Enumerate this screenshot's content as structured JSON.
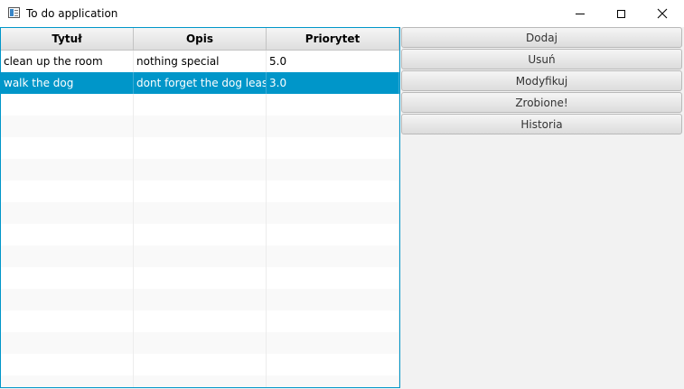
{
  "window": {
    "title": "To do application",
    "controls": [
      "minimize",
      "maximize",
      "close"
    ]
  },
  "table": {
    "columns": [
      "Tytuł",
      "Opis",
      "Priorytet"
    ],
    "rows": [
      {
        "title": "clean up the room",
        "description": "nothing special",
        "priority": "5.0",
        "selected": false
      },
      {
        "title": "walk the dog",
        "description": "dont forget the dog leash",
        "priority": "3.0",
        "selected": true
      }
    ],
    "selected_color": "#0096c9"
  },
  "actions": {
    "add": "Dodaj",
    "remove": "Usuń",
    "modify": "Modyfikuj",
    "done": "Zrobione!",
    "history": "Historia"
  }
}
